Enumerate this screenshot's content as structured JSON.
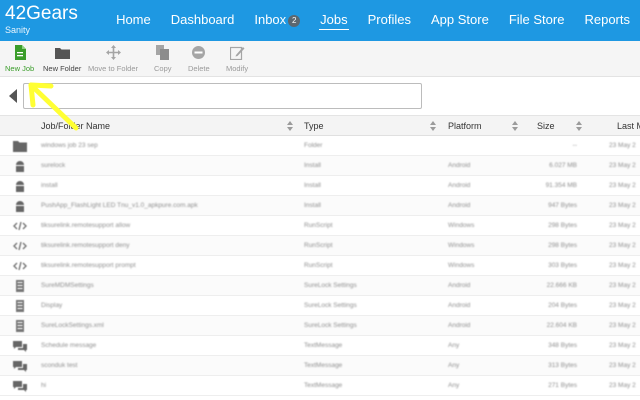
{
  "brand": {
    "name": "42Gears",
    "subtitle": "Sanity"
  },
  "nav": {
    "items": [
      {
        "label": "Home"
      },
      {
        "label": "Dashboard"
      },
      {
        "label": "Inbox",
        "badge": "2"
      },
      {
        "label": "Jobs",
        "active": true
      },
      {
        "label": "Profiles"
      },
      {
        "label": "App Store"
      },
      {
        "label": "File Store"
      },
      {
        "label": "Reports"
      }
    ]
  },
  "toolbar": {
    "new_job": "New Job",
    "new_folder": "New Folder",
    "move_to_folder": "Move to Folder",
    "copy": "Copy",
    "delete": "Delete",
    "modify": "Modify"
  },
  "path": {
    "value": ""
  },
  "table": {
    "columns": {
      "name": "Job/Folder Name",
      "type": "Type",
      "platform": "Platform",
      "size": "Size",
      "last": "Last M"
    },
    "rows": [
      {
        "icon": "folder-icon",
        "name": "windows job 23 sep",
        "type": "Folder",
        "platform": "",
        "size": "--",
        "last": "23 May 2"
      },
      {
        "icon": "android-icon",
        "name": "surelock",
        "type": "Install",
        "platform": "Android",
        "size": "6.027 MB",
        "last": "23 May 2"
      },
      {
        "icon": "android-icon",
        "name": "install",
        "type": "Install",
        "platform": "Android",
        "size": "91.354 MB",
        "last": "23 May 2"
      },
      {
        "icon": "android-icon",
        "name": "PushApp_FlashLight LED Tnu_v1.0_apkpure.com.apk",
        "type": "Install",
        "platform": "Android",
        "size": "947 Bytes",
        "last": "23 May 2"
      },
      {
        "icon": "script-icon",
        "name": "tiksurelink.remotesupport allow",
        "type": "RunScript",
        "platform": "Windows",
        "size": "298 Bytes",
        "last": "23 May 2"
      },
      {
        "icon": "script-icon",
        "name": "tiksurelink.remotesupport deny",
        "type": "RunScript",
        "platform": "Windows",
        "size": "298 Bytes",
        "last": "23 May 2"
      },
      {
        "icon": "script-icon",
        "name": "tiksurelink.remotesupport prompt",
        "type": "RunScript",
        "platform": "Windows",
        "size": "303 Bytes",
        "last": "23 May 2"
      },
      {
        "icon": "settings-doc-icon",
        "name": "SureMDMSettings",
        "type": "SureLock Settings",
        "platform": "Android",
        "size": "22.666 KB",
        "last": "23 May 2"
      },
      {
        "icon": "settings-doc-icon",
        "name": "Display",
        "type": "SureLock Settings",
        "platform": "Android",
        "size": "204 Bytes",
        "last": "23 May 2"
      },
      {
        "icon": "settings-doc-icon",
        "name": "SureLockSettings.xml",
        "type": "SureLock Settings",
        "platform": "Android",
        "size": "22.604 KB",
        "last": "23 May 2"
      },
      {
        "icon": "message-icon",
        "name": "Schedule message",
        "type": "TextMessage",
        "platform": "Any",
        "size": "348 Bytes",
        "last": "23 May 2"
      },
      {
        "icon": "message-icon",
        "name": "sconduk test",
        "type": "TextMessage",
        "platform": "Any",
        "size": "313 Bytes",
        "last": "23 May 2"
      },
      {
        "icon": "message-icon",
        "name": "hi",
        "type": "TextMessage",
        "platform": "Any",
        "size": "271 Bytes",
        "last": "23 May 2"
      }
    ]
  },
  "colors": {
    "topbar": "#1e98e2",
    "new_job_green": "#3a9d2a",
    "annotation_yellow": "#ffff33"
  }
}
